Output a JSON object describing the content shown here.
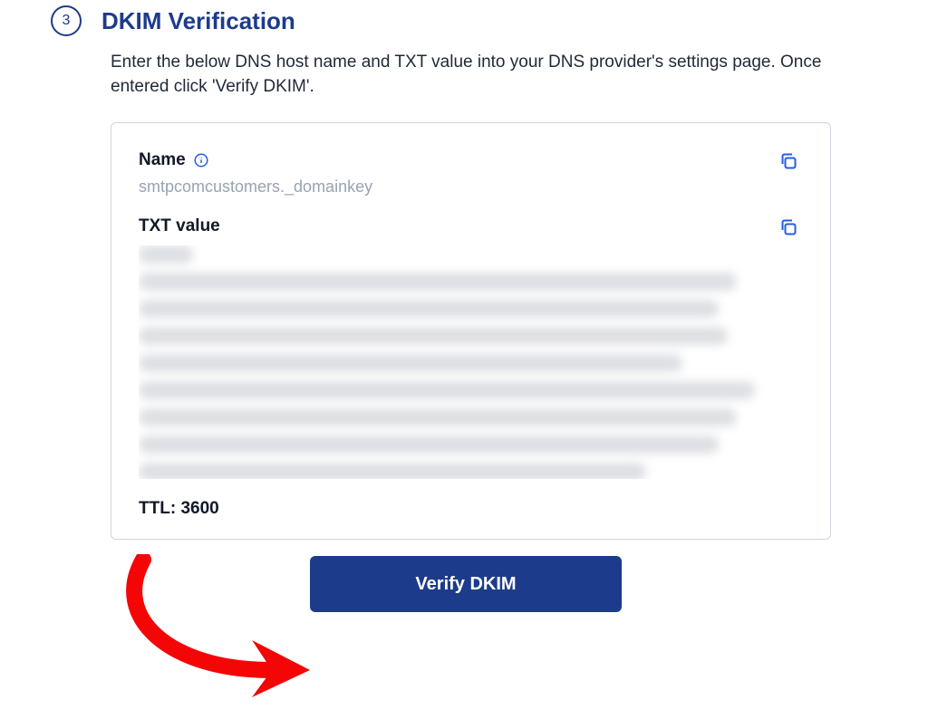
{
  "step": {
    "number": "3",
    "title": "DKIM Verification",
    "description": "Enter the below DNS host name and TXT value into your DNS provider's settings page. Once entered click 'Verify DKIM'."
  },
  "record": {
    "name_label": "Name",
    "name_value": "smtpcomcustomers._domainkey",
    "txt_label": "TXT value",
    "txt_value_obscured": true,
    "ttl_label": "TTL:",
    "ttl_value": "3600"
  },
  "buttons": {
    "verify": "Verify DKIM"
  },
  "icons": {
    "info": "info-circle",
    "copy": "copy"
  }
}
